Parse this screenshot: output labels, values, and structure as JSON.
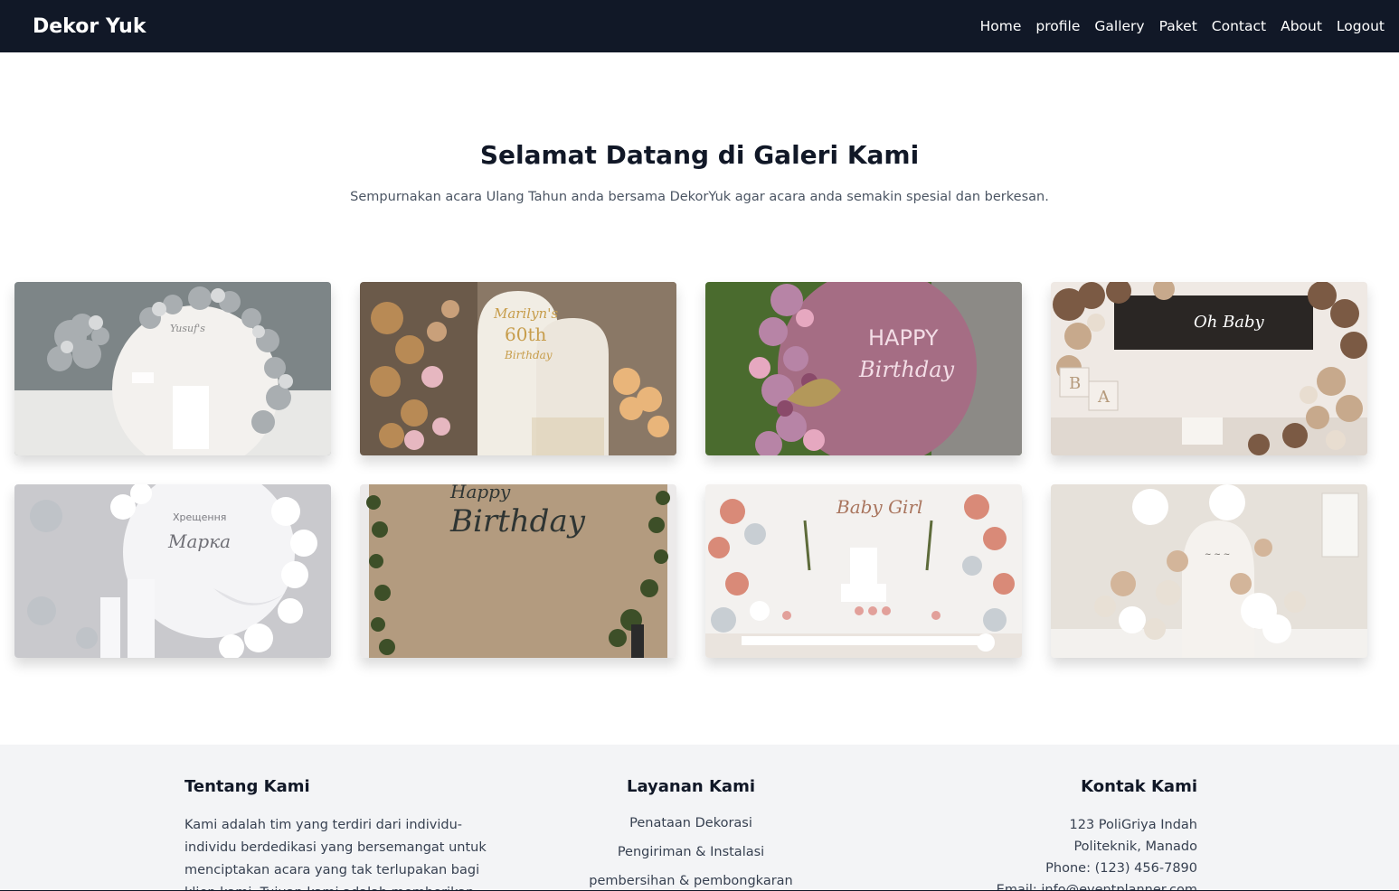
{
  "nav": {
    "brand": "Dekor Yuk",
    "links": [
      "Home",
      "profile",
      "Gallery",
      "Paket",
      "Contact",
      "About",
      "Logout"
    ]
  },
  "hero": {
    "title": "Selamat Datang di Galeri Kami",
    "subtitle": "Sempurnakan acara Ulang Tahun anda bersama DekorYuk agar acara anda semakin spesial dan berkesan."
  },
  "gallery": {
    "images": [
      {
        "name": "gallery-image-grey-balloon-arch",
        "text": "Yusuf's",
        "palette": "grey"
      },
      {
        "name": "gallery-image-60th-birthday",
        "text": "Marilyn's 60th Birthday",
        "palette": "gold"
      },
      {
        "name": "gallery-image-happy-birthday-mauve",
        "text": "HAPPY Birthday",
        "palette": "mauve"
      },
      {
        "name": "gallery-image-oh-baby",
        "text": "Oh Baby",
        "palette": "brown"
      },
      {
        "name": "gallery-image-baptism-silver",
        "text": "Хрещення Марка",
        "palette": "silver"
      },
      {
        "name": "gallery-image-happy-birthday-kraft",
        "text": "Birthday",
        "palette": "kraft"
      },
      {
        "name": "gallery-image-baby-girl",
        "text": "Baby Girl",
        "palette": "peach"
      },
      {
        "name": "gallery-image-white-beige-balloons",
        "text": "",
        "palette": "cream"
      }
    ]
  },
  "footer": {
    "about": {
      "title": "Tentang Kami",
      "text": "Kami adalah tim yang terdiri dari individu-individu berdedikasi yang bersemangat untuk menciptakan acara yang tak terlupakan bagi klien kami. Tujuan kami adalah memberikan Anda"
    },
    "services": {
      "title": "Layanan Kami",
      "items": [
        "Penataan Dekorasi",
        "Pengiriman & Instalasi",
        "pembersihan & pembongkaran"
      ]
    },
    "contact": {
      "title": "Kontak Kami",
      "address1": "123 PoliGriya Indah",
      "address2": "Politeknik, Manado",
      "phone": "Phone: (123) 456-7890",
      "email": "Email: info@eventplanner.com"
    }
  },
  "colors": {
    "navbar": "#111827",
    "footer_bg": "#f3f4f6"
  }
}
